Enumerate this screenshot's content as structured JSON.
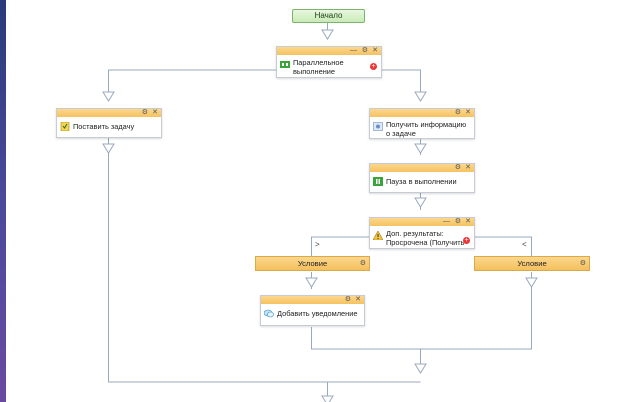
{
  "start": {
    "label": "Начало"
  },
  "nodes": {
    "parallel": {
      "label": "Параллельное выполнение",
      "icon": "parallel-icon"
    },
    "set_task": {
      "label": "Поставить задачу",
      "icon": "task-icon"
    },
    "get_info": {
      "label": "Получить информацию о задаче",
      "icon": "info-icon"
    },
    "pause": {
      "label": "Пауза в выполнении",
      "icon": "pause-icon"
    },
    "extra": {
      "label": "Доп. результаты: Просрочена (Получить",
      "icon": "warning-icon"
    },
    "notify": {
      "label": "Добавить уведомление",
      "icon": "notification-icon"
    }
  },
  "conditions": {
    "left": {
      "label": "Условие",
      "marker": ">"
    },
    "right": {
      "label": "Условие",
      "marker": "<"
    }
  },
  "controls": {
    "minimize": "—",
    "settings": "⚙",
    "close": "✕",
    "add": "+"
  },
  "colors": {
    "header": "#f5c25f",
    "start_fill": "#d6f0c8",
    "connector": "#9aa9bf",
    "add_button": "#e33333"
  }
}
